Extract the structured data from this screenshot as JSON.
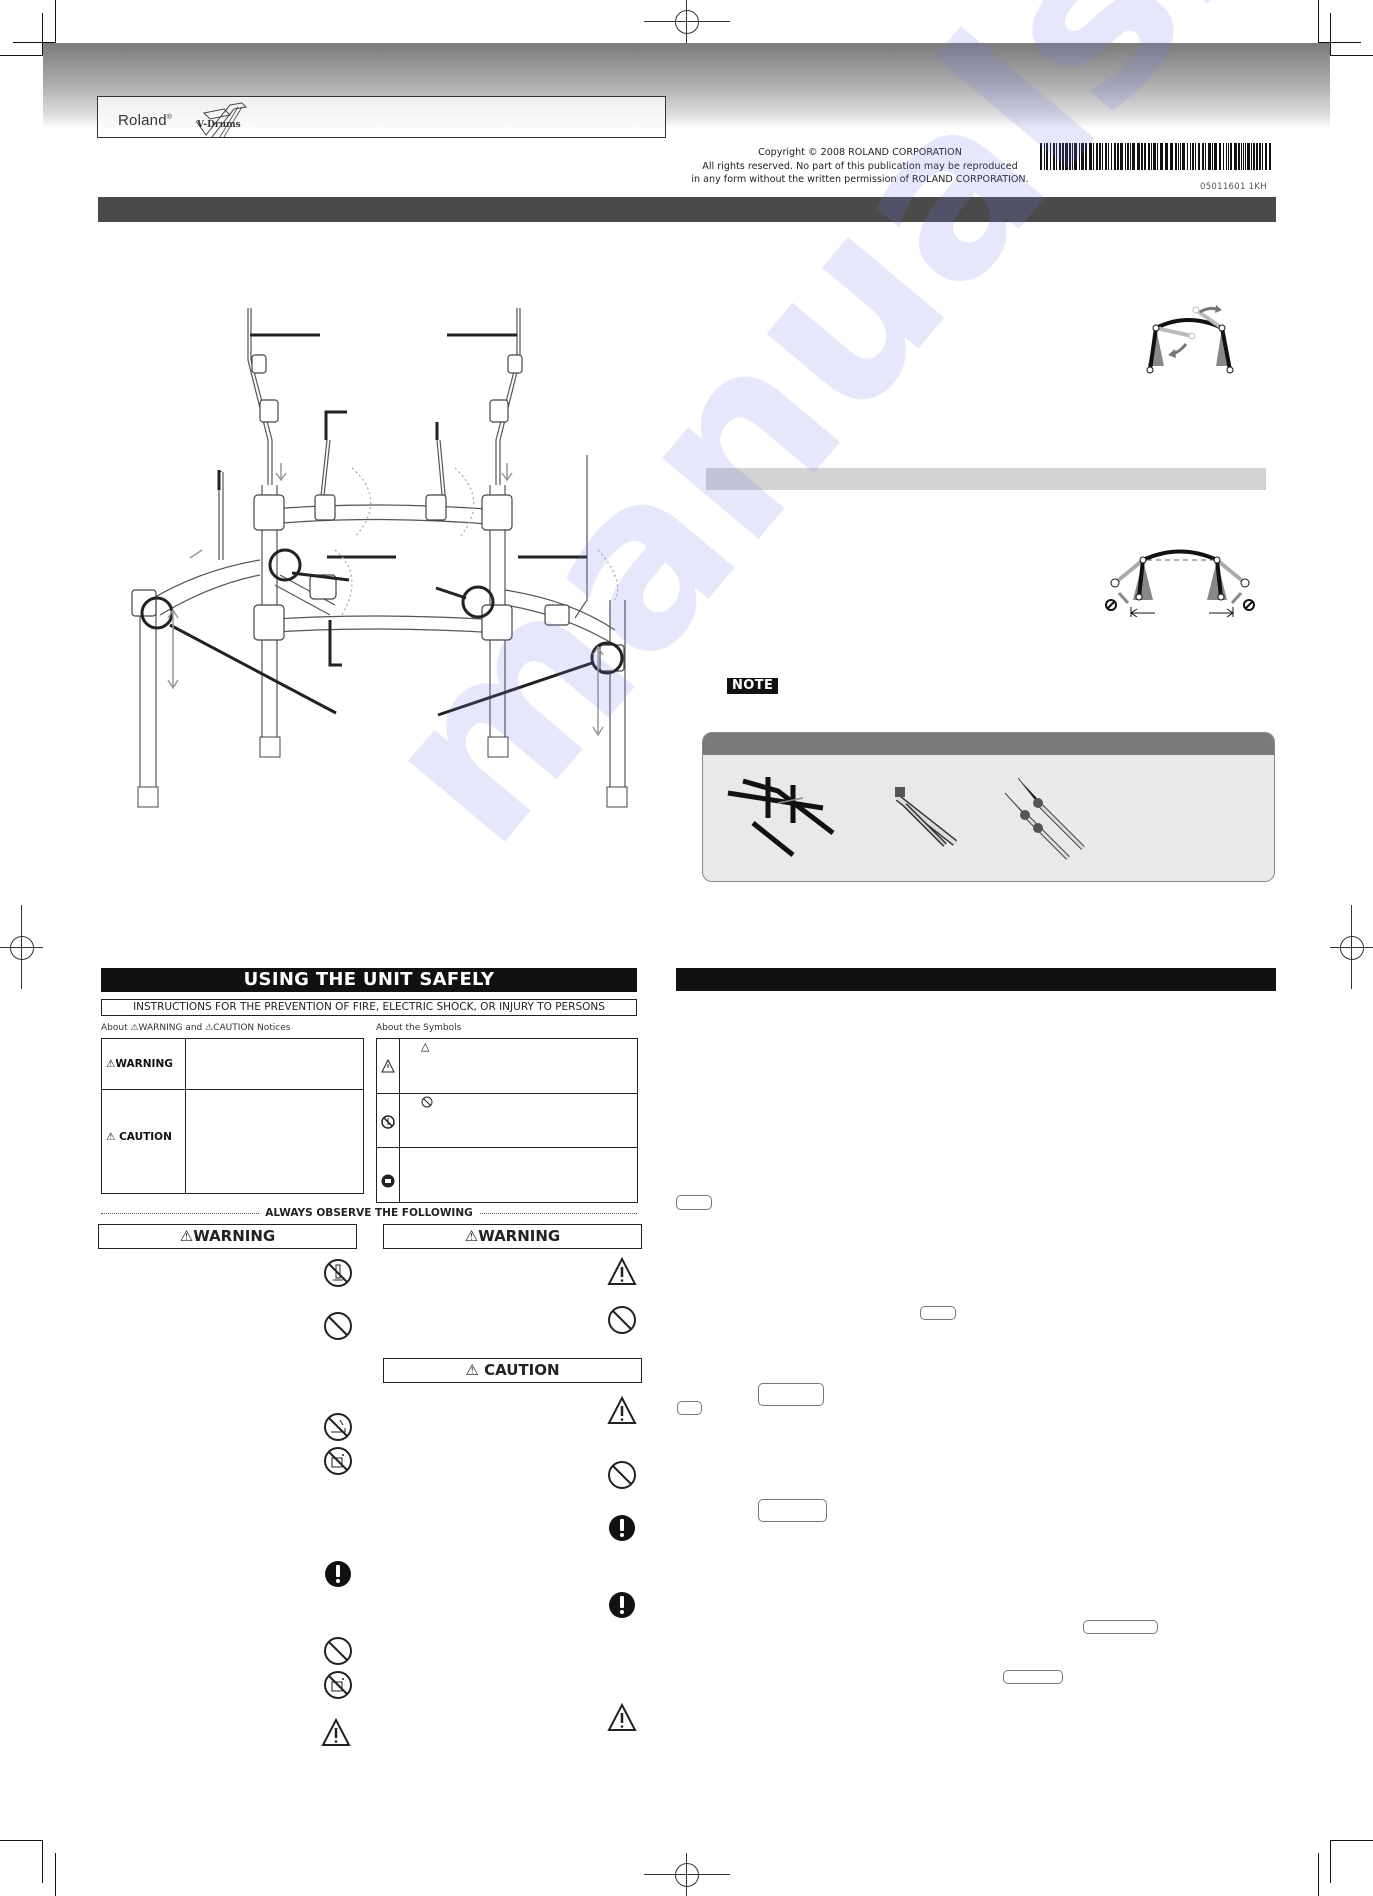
{
  "header": {
    "brand": "Roland",
    "brand_mark": "®",
    "product_logo": "V-Drums",
    "copyright_lines": [
      "Copyright © 2008 ROLAND CORPORATION",
      "All rights reserved. No part of this publication may be reproduced",
      "in any form without the written permission of ROLAND CORPORATION."
    ],
    "document_number": "05011601    1KH"
  },
  "assembly": {
    "diagram_icon": "drum-rack-diagram",
    "adjust_diagram_icon": "arm-rotation-diagram",
    "spread_diagram_icon": "leg-spread-diagram",
    "note_label": "NOTE",
    "parts_icons": [
      "main-rack-frame",
      "leg-pipe-assembly",
      "cymbal-arm-pair"
    ]
  },
  "safety": {
    "title": "USING THE UNIT SAFELY",
    "subtitle": "INSTRUCTIONS FOR THE PREVENTION OF FIRE, ELECTRIC SHOCK, OR INJURY TO PERSONS",
    "notices_caption": "About ⚠WARNING and ⚠CAUTION Notices",
    "symbols_caption": "About the Symbols",
    "levels": [
      {
        "label": "WARNING"
      },
      {
        "label": "CAUTION"
      }
    ],
    "symbol_rows": [
      {
        "icon": "warning-triangle-icon",
        "inline_icon": "△"
      },
      {
        "icon": "prohibition-icon",
        "inline_icon": "⃠"
      },
      {
        "icon": "mandatory-action-icon",
        "inline_icon": ""
      }
    ],
    "observe_label": "ALWAYS OBSERVE THE FOLLOWING",
    "left_column_banner": "WARNING",
    "right_column_banners": [
      "WARNING",
      "CAUTION"
    ],
    "left_icons": [
      "no-disassemble-icon",
      "prohibition-icon",
      "no-water-icon",
      "no-foreign-objects-icon",
      "mandatory-action-icon",
      "prohibition-icon",
      "no-foreign-objects-icon",
      "warning-triangle-icon"
    ],
    "right_icons": [
      "warning-triangle-icon",
      "prohibition-icon",
      "warning-triangle-icon",
      "prohibition-icon",
      "mandatory-action-icon",
      "mandatory-action-icon",
      "warning-triangle-icon"
    ]
  },
  "watermark": "manualsive.com"
}
